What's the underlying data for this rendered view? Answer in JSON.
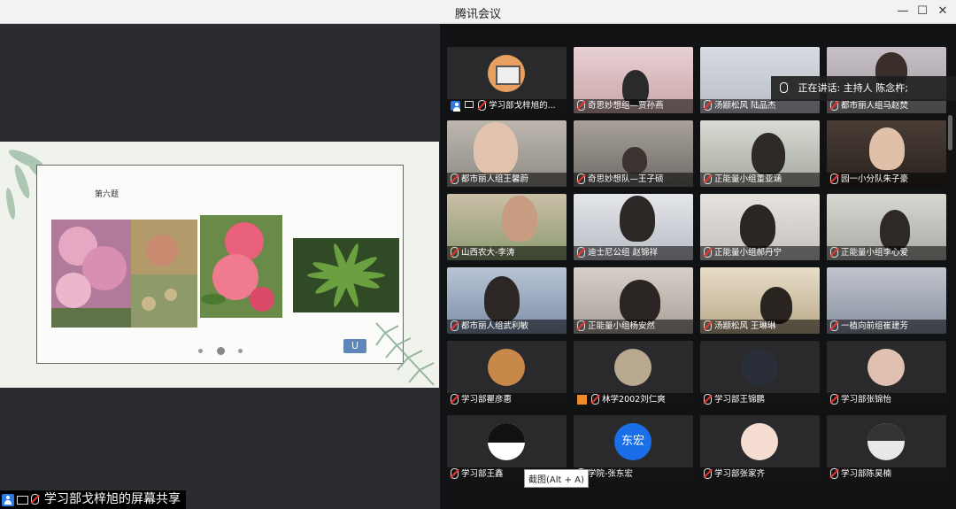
{
  "window": {
    "title": "腾讯会议"
  },
  "slide": {
    "title": "第六题",
    "nav_label": "U"
  },
  "share_label": "学习部戈梓旭的屏幕共享",
  "speaking_now": "正在讲话: 主持人 陈念杵;",
  "tooltip": "截图(Alt + A)",
  "participants": [
    {
      "name": "学习部戈梓旭的..."
    },
    {
      "name": "奇思妙想组—贾孙燕"
    },
    {
      "name": "汤颛松风 陆品杰"
    },
    {
      "name": "都市丽人组马赵焚"
    },
    {
      "name": "都市丽人组王馨蔚"
    },
    {
      "name": "奇思妙想队—王子硕"
    },
    {
      "name": "正能量小组董亚涵"
    },
    {
      "name": "园一小分队朱子豪"
    },
    {
      "name": "山西农大-李涛"
    },
    {
      "name": "迪士尼公组 赵锦祥"
    },
    {
      "name": "正能量小组郝丹宁"
    },
    {
      "name": "正能量小组李心爱"
    },
    {
      "name": "都市丽人组武利敏"
    },
    {
      "name": "正能量小组杨安然"
    },
    {
      "name": "汤颛松风 王琳琳"
    },
    {
      "name": "一植向前组崔建芳"
    },
    {
      "name": "学习部瞿彦惠"
    },
    {
      "name": "林学2002刘仁爽"
    },
    {
      "name": "学习部王锦鹏"
    },
    {
      "name": "学习部张锦怡"
    },
    {
      "name": "学习部王鑫"
    },
    {
      "name": "学院-张东宏",
      "avatar_text": "东宏"
    },
    {
      "name": "学习部张家齐"
    },
    {
      "name": "学习部陈昊楠"
    }
  ]
}
